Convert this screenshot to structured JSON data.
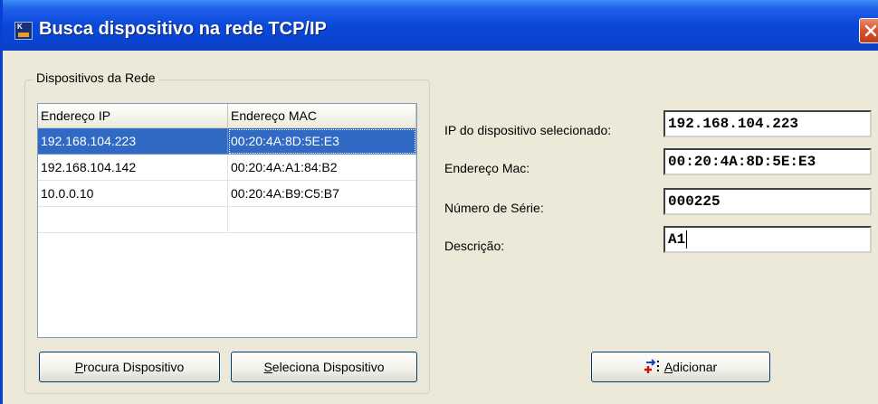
{
  "window": {
    "title": "Busca dispositivo na rede TCP/IP"
  },
  "group": {
    "label": "Dispositivos da Rede"
  },
  "list": {
    "columns": [
      "Endereço IP",
      "Endereço MAC"
    ],
    "rows": [
      {
        "ip": "192.168.104.223",
        "mac": "00:20:4A:8D:5E:E3",
        "selected": true
      },
      {
        "ip": "192.168.104.142",
        "mac": "00:20:4A:A1:84:B2",
        "selected": false
      },
      {
        "ip": "10.0.0.10",
        "mac": "00:20:4A:B9:C5:B7",
        "selected": false
      },
      {
        "ip": "",
        "mac": "",
        "selected": false
      }
    ]
  },
  "buttons": {
    "procura": {
      "mnemonic": "P",
      "rest": "rocura Dispositivo"
    },
    "seleciona": {
      "mnemonic": "S",
      "rest": "eleciona Dispositivo"
    },
    "adicionar": {
      "mnemonic": "A",
      "rest": "dicionar"
    }
  },
  "details": {
    "ip_label": "IP do dispositivo selecionado:",
    "ip_value": "192.168.104.223",
    "mac_label": "Endereço Mac:",
    "mac_value": "00:20:4A:8D:5E:E3",
    "serial_label": "Número de Série:",
    "serial_value": "000225",
    "desc_label": "Descrição:",
    "desc_value": "A1"
  },
  "icons": {
    "app": "app-icon",
    "close": "close-icon",
    "add": "add-device-icon"
  },
  "colors": {
    "titlebar": "#0a44d2",
    "selection": "#316ac5",
    "close": "#d8532e"
  }
}
